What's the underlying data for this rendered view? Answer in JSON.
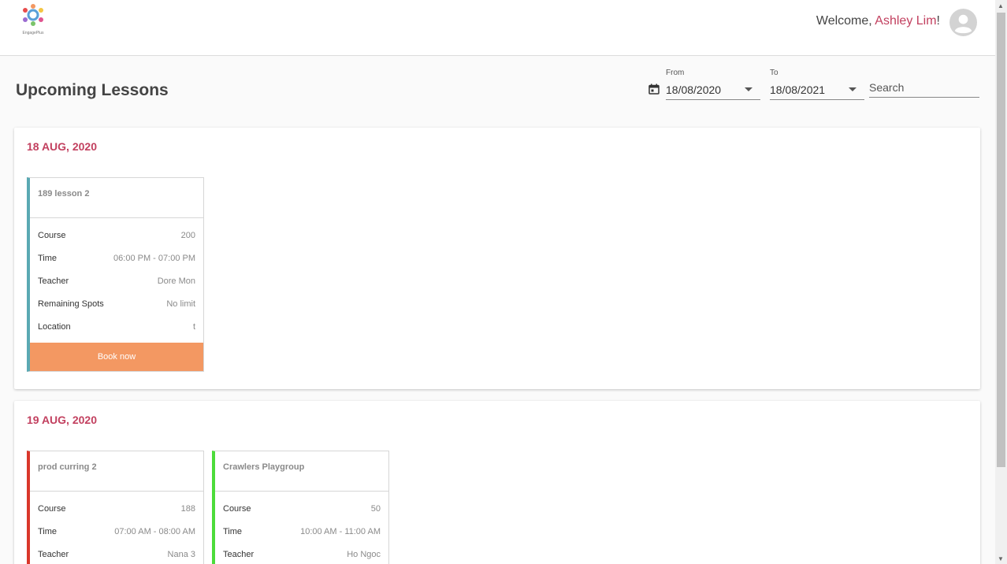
{
  "brand": {
    "logo_text": "EngagePlus"
  },
  "header": {
    "welcome_prefix": "Welcome, ",
    "user_name": "Ashley Lim",
    "welcome_suffix": "!"
  },
  "page": {
    "title": "Upcoming Lessons"
  },
  "filters": {
    "from_label": "From",
    "from_value": "18/08/2020",
    "to_label": "To",
    "to_value": "18/08/2021",
    "search_placeholder": "Search"
  },
  "labels": {
    "course": "Course",
    "time": "Time",
    "teacher": "Teacher",
    "remaining_spots": "Remaining Spots",
    "location": "Location",
    "book_now": "Book now"
  },
  "days": [
    {
      "date": "18 AUG, 2020",
      "lessons": [
        {
          "title": "189 lesson 2",
          "accent": "#5aa9b3",
          "course": "200",
          "time": "06:00 PM - 07:00 PM",
          "teacher": "Dore Mon",
          "remaining_spots": "No limit",
          "location": "t"
        }
      ]
    },
    {
      "date": "19 AUG, 2020",
      "lessons": [
        {
          "title": "prod curring 2",
          "accent": "#d9372b",
          "course": "188",
          "time": "07:00 AM - 08:00 AM",
          "teacher": "Nana 3"
        },
        {
          "title": "Crawlers Playgroup",
          "accent": "#4cdc3a",
          "course": "50",
          "time": "10:00 AM - 11:00 AM",
          "teacher": "Ho Ngoc"
        }
      ]
    }
  ],
  "colors": {
    "accent_text": "#c2405f",
    "book_button": "#f39862"
  },
  "icons": {
    "calendar": "calendar-icon",
    "user": "user-avatar-icon",
    "logo": "logo-icon"
  }
}
